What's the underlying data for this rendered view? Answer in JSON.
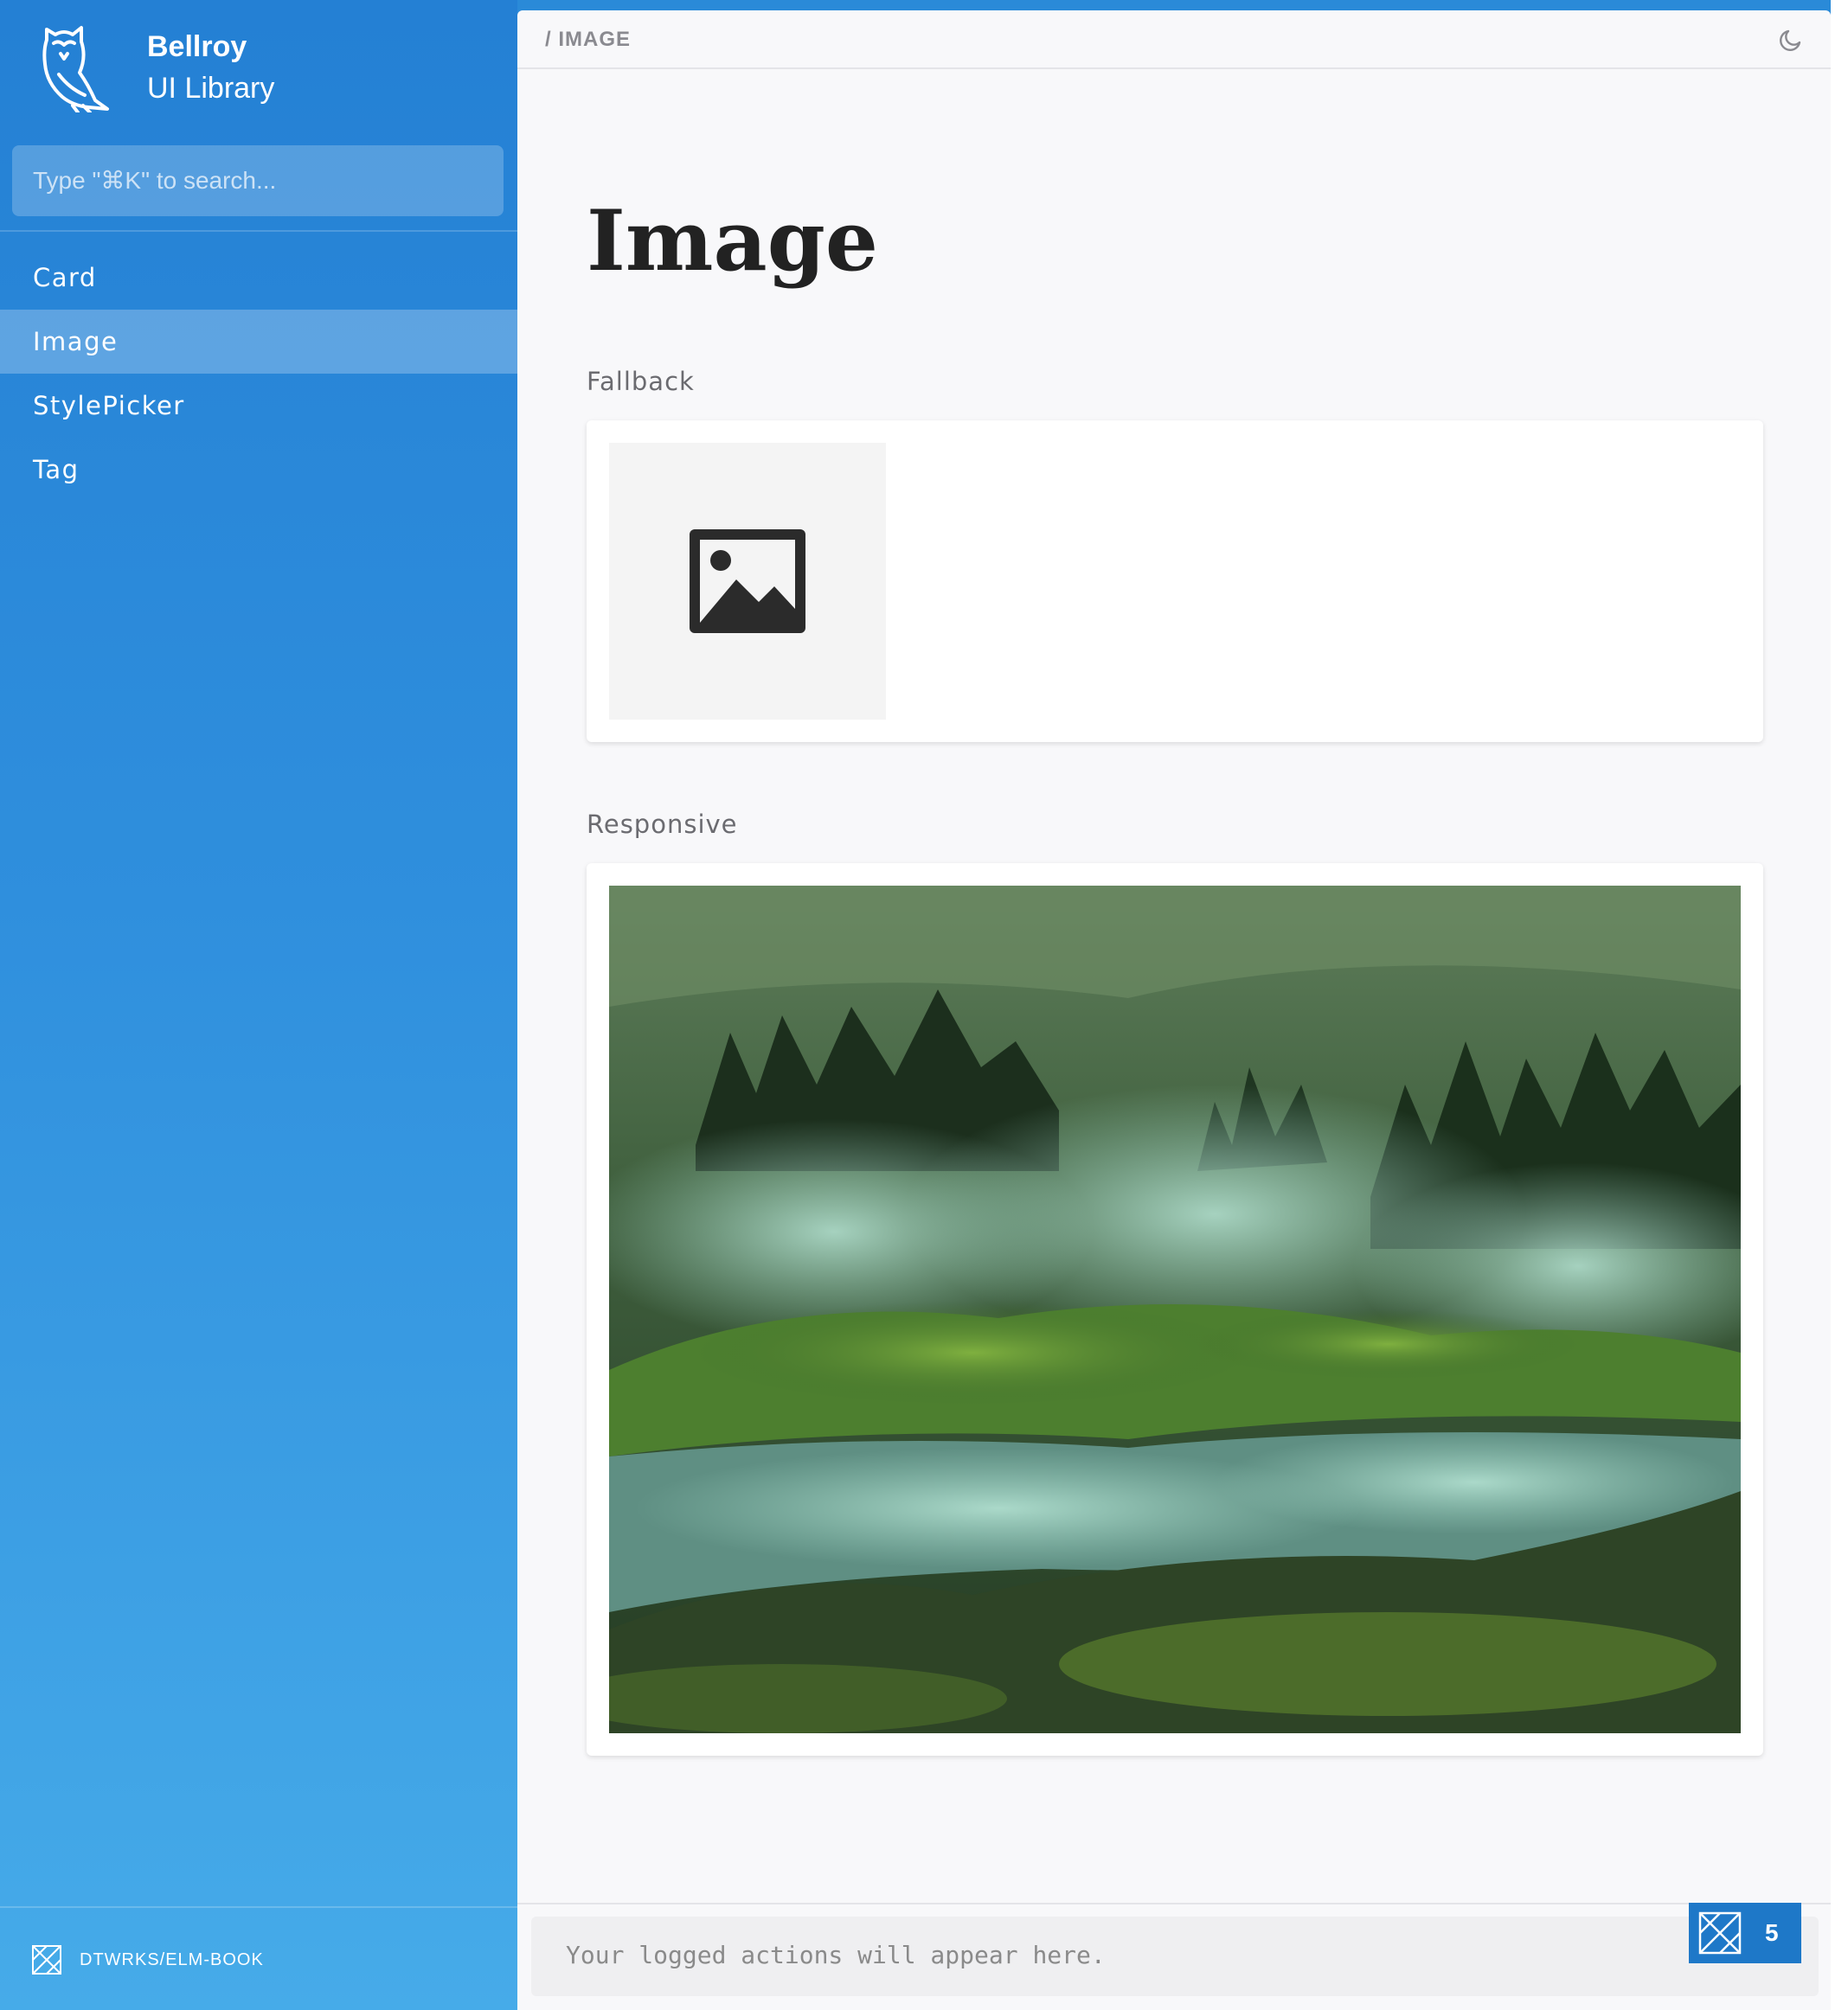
{
  "sidebar": {
    "brand": {
      "title": "Bellroy",
      "subtitle": "UI Library"
    },
    "search": {
      "placeholder": "Type \"⌘K\" to search..."
    },
    "items": [
      {
        "label": "Card",
        "active": false
      },
      {
        "label": "Image",
        "active": true
      },
      {
        "label": "StylePicker",
        "active": false
      },
      {
        "label": "Tag",
        "active": false
      }
    ],
    "footer": {
      "label": "DTWRKS/ELM-BOOK",
      "icon": "elm-book-logo-icon"
    }
  },
  "topbar": {
    "breadcrumb": "/ IMAGE",
    "theme_icon": "moon-icon"
  },
  "main": {
    "title": "Image",
    "sections": [
      {
        "label": "Fallback",
        "icon": "image-placeholder-icon"
      },
      {
        "label": "Responsive"
      }
    ]
  },
  "actions_log": {
    "placeholder": "Your logged actions will appear here.",
    "count": "5"
  },
  "colors": {
    "sidebar_top": "#2480d4",
    "sidebar_bottom": "#46abe9",
    "active_item": "rgba(255,255,255,0.25)",
    "badge": "#1e78c8"
  }
}
